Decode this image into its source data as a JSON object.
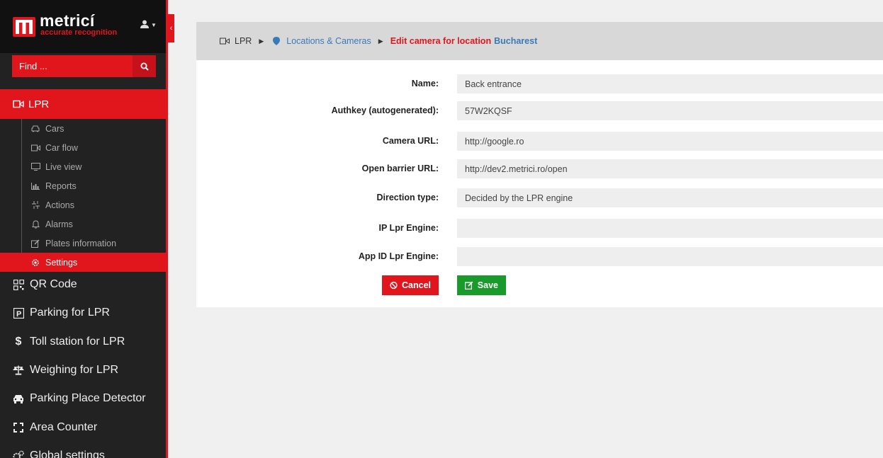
{
  "brand": {
    "name": "metricí",
    "tagline": "accurate recognition",
    "accent": "#e0161c"
  },
  "search": {
    "placeholder": "Find ..."
  },
  "nav": {
    "lpr_label": "LPR",
    "sub_items": [
      {
        "label": "Cars",
        "icon": "car-icon"
      },
      {
        "label": "Car flow",
        "icon": "video-camera-icon"
      },
      {
        "label": "Live view",
        "icon": "monitor-icon"
      },
      {
        "label": "Reports",
        "icon": "bar-chart-icon"
      },
      {
        "label": "Actions",
        "icon": "actions-icon"
      },
      {
        "label": "Alarms",
        "icon": "bell-icon"
      },
      {
        "label": "Plates information",
        "icon": "edit-icon"
      },
      {
        "label": "Settings",
        "icon": "gear-icon"
      }
    ],
    "main_items": [
      {
        "label": "QR Code",
        "icon": "qr-code-icon"
      },
      {
        "label": "Parking for LPR",
        "icon": "parking-icon"
      },
      {
        "label": "Toll station for LPR",
        "icon": "dollar-icon"
      },
      {
        "label": "Weighing for LPR",
        "icon": "balance-scale-icon"
      },
      {
        "label": "Parking Place Detector",
        "icon": "car-icon"
      },
      {
        "label": "Area Counter",
        "icon": "expand-icon"
      },
      {
        "label": "Global settings",
        "icon": "gears-icon"
      }
    ]
  },
  "breadcrumb": {
    "root": "LPR",
    "locations": "Locations & Cameras",
    "current": "Edit camera for location",
    "location_name": "Bucharest"
  },
  "form": {
    "name_label": "Name:",
    "name_value": "Back entrance",
    "authkey_label": "Authkey (autogenerated):",
    "authkey_value": "57W2KQSF",
    "camera_url_label": "Camera URL:",
    "camera_url_value": "http://google.ro",
    "barrier_url_label": "Open barrier URL:",
    "barrier_url_value": "http://dev2.metrici.ro/open",
    "direction_label": "Direction type:",
    "direction_value": "Decided by the LPR engine",
    "ip_label": "IP Lpr Engine:",
    "ip_value": "",
    "appid_label": "App ID Lpr Engine:",
    "appid_value": "",
    "cancel_label": "Cancel",
    "save_label": "Save"
  }
}
